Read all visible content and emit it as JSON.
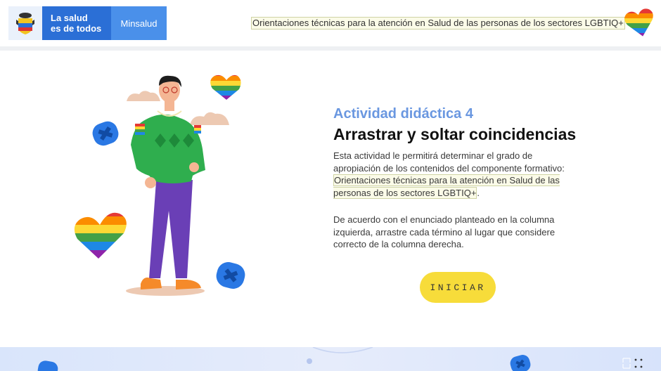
{
  "header": {
    "logo_text_line1": "La salud",
    "logo_text_line2": "es de todos",
    "logo_brand": "Minsalud",
    "course_title": "Orientaciones técnicas para la atención en Salud de las personas de los sectores LGBTIQ+"
  },
  "main": {
    "kicker": "Actividad didáctica 4",
    "title": "Arrastrar y soltar coincidencias",
    "intro": "Esta actividad le permitirá determinar el grado de apropiación de los contenidos del componente formativo:",
    "intro_highlight": "Orientaciones técnicas para la atención en Salud de las personas de los sectores LGBTIQ+",
    "intro_end": ".",
    "instructions": "De acuerdo con el enunciado planteado en la columna izquierda, arrastre cada término al lugar que considere correcto de la columna derecha.",
    "start_button": "INICIAR"
  },
  "colors": {
    "brand_blue": "#2b6fd6",
    "brand_light_blue": "#4a90ea",
    "kicker_blue": "#6a97e0",
    "button_yellow": "#f7dc3a",
    "highlight_bg": "#fbfbe8"
  },
  "icons": {
    "shield": "colombia-shield-icon",
    "heart": "rainbow-heart-icon",
    "puzzle": "puzzle-piece-icon"
  }
}
